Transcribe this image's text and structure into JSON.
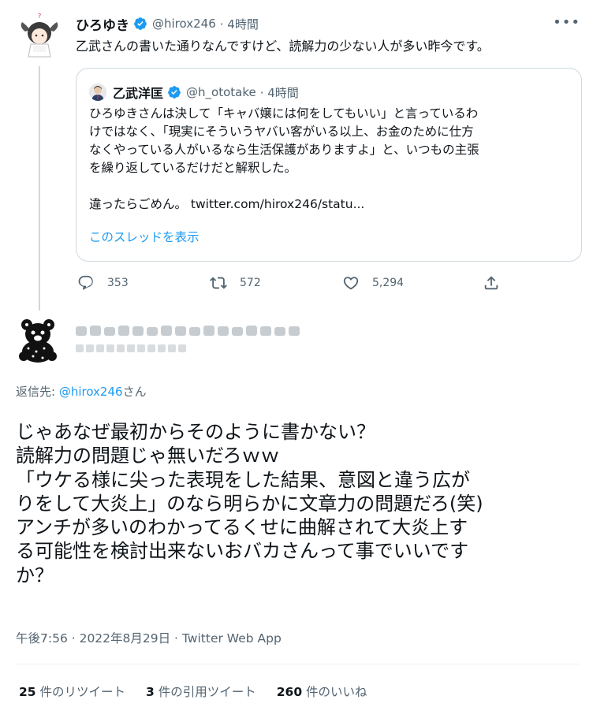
{
  "parent_tweet": {
    "name": "ひろゆき",
    "handle": "@hirox246",
    "time": "· 4時間",
    "text": "乙武さんの書いた通りなんですけど、読解力の少ない人が多い昨今です。",
    "quote": {
      "name": "乙武洋匡",
      "handle": "@h_ototake",
      "time": "· 4時間",
      "lines": [
        "ひろゆきさんは決して「キャバ嬢には何をしてもいい」と言っているわ",
        "けではなく、「現実にそういうヤバい客がいる以上、お金のために仕方",
        "なくやっている人がいるなら生活保護がありますよ」と、いつもの主張",
        "を繰り返しているだけだと解釈した。",
        "",
        "違ったらごめん。 twitter.com/hirox246/statu..."
      ],
      "show_thread": "このスレッドを表示"
    },
    "actions": {
      "reply_count": "353",
      "retweet_count": "572",
      "like_count": "5,294"
    }
  },
  "main_tweet": {
    "reply_prefix": "返信先: ",
    "reply_handle": "@hirox246",
    "reply_suffix": "さん",
    "lines": [
      "じゃあなぜ最初からそのように書かない？",
      "読解力の問題じゃ無いだろｗｗ",
      "「ウケる様に尖った表現をした結果、意図と違う広が",
      "りをして大炎上」のなら明らかに文章力の問題だろ(笑)",
      "アンチが多いのわかってるくせに曲解されて大炎上す",
      "る可能性を検討出来ないおバカさんって事でいいです",
      "か？"
    ],
    "timestamp": "午後7:56 · 2022年8月29日 · Twitter Web App",
    "stats": {
      "retweets": {
        "count": "25",
        "label": " 件のリツイート"
      },
      "quotes": {
        "count": "3",
        "label": " 件の引用ツイート"
      },
      "likes": {
        "count": "260",
        "label": " 件のいいね"
      }
    }
  },
  "icons": {
    "verified": "verified-badge-icon",
    "reply": "reply-icon",
    "retweet": "retweet-icon",
    "like": "heart-icon",
    "share": "share-icon",
    "more": "more-options-icon"
  },
  "colors": {
    "accent": "#1d9bf0",
    "muted": "#536471",
    "text": "#0f1419",
    "border": "#cfd9de"
  }
}
